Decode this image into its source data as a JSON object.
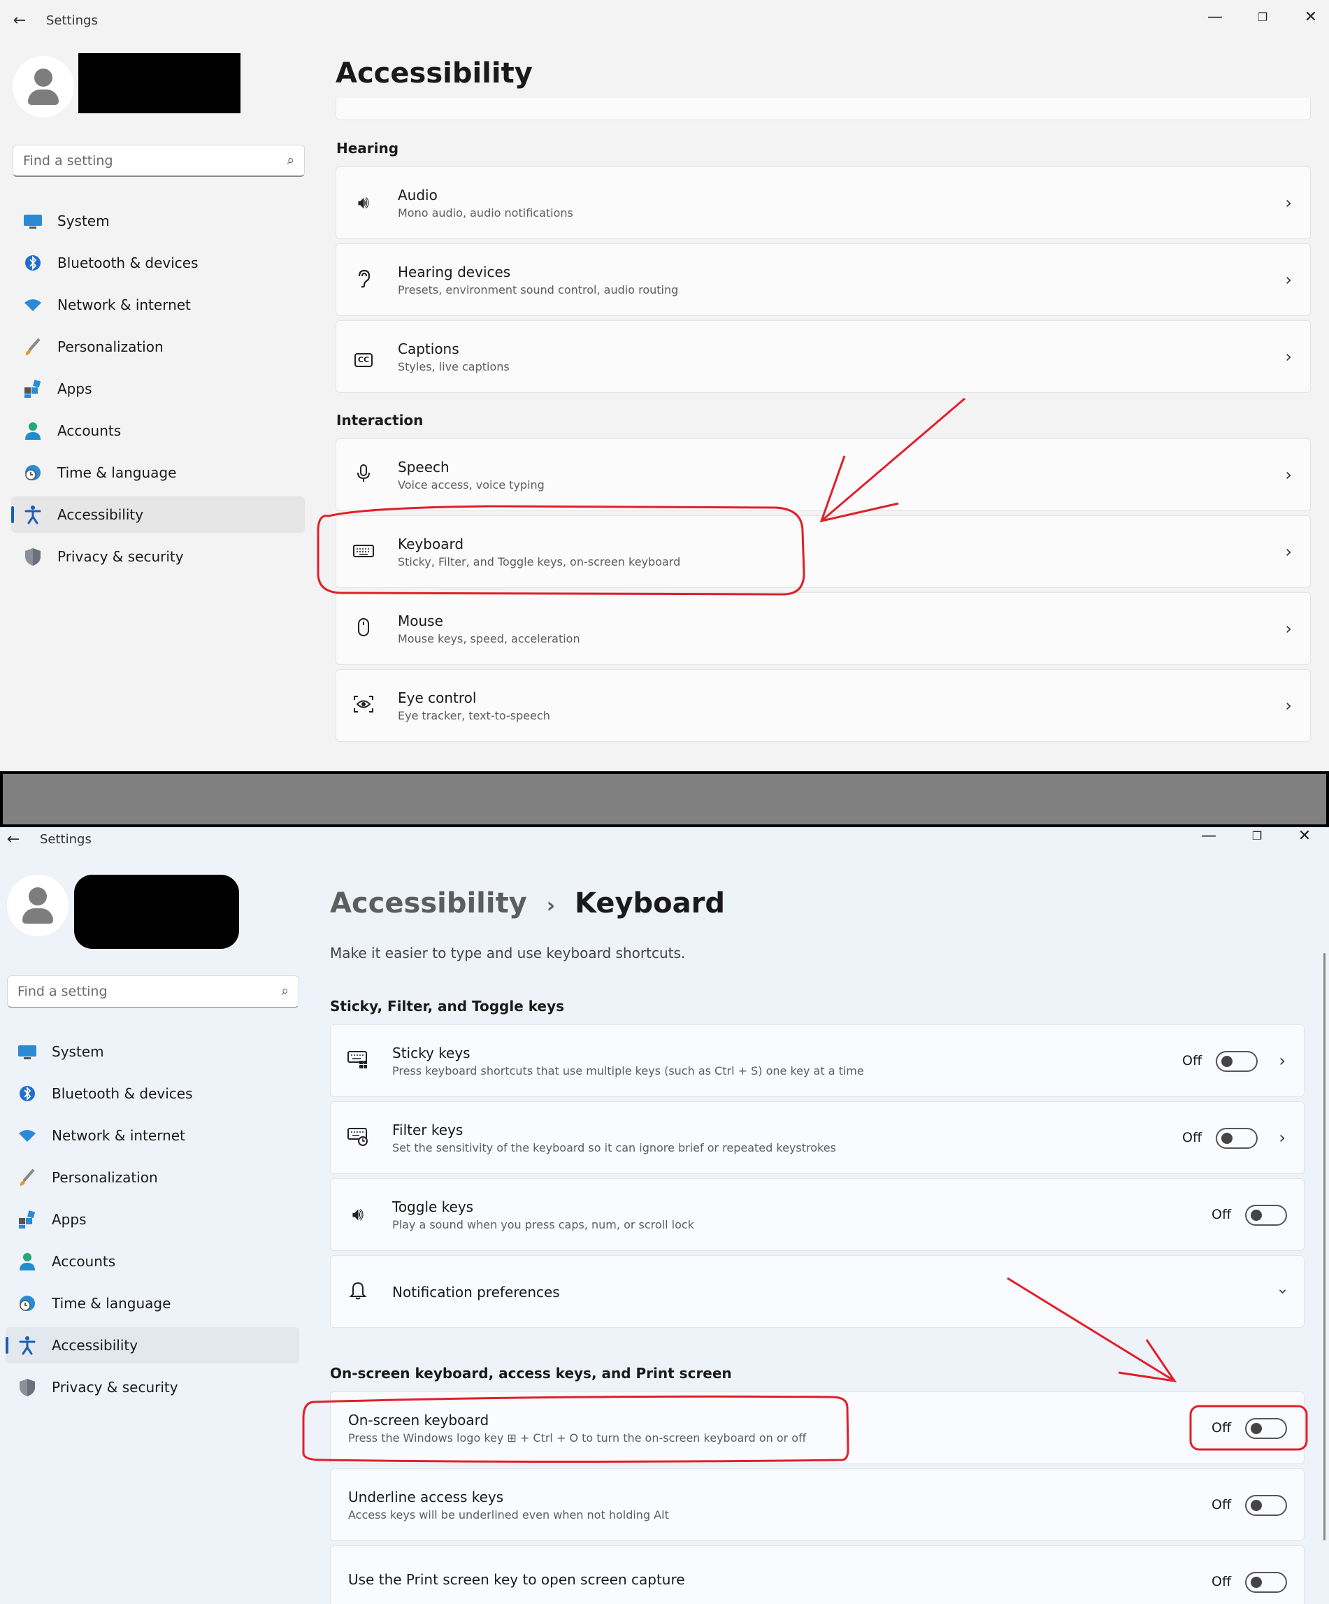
{
  "app": {
    "title": "Settings"
  },
  "window_controls": {
    "minimize": "—",
    "maximize": "❐",
    "close": "✕"
  },
  "search": {
    "placeholder": "Find a setting"
  },
  "nav": [
    {
      "label": "System",
      "icon": "monitor-icon"
    },
    {
      "label": "Bluetooth & devices",
      "icon": "bluetooth-icon"
    },
    {
      "label": "Network & internet",
      "icon": "wifi-icon"
    },
    {
      "label": "Personalization",
      "icon": "brush-icon"
    },
    {
      "label": "Apps",
      "icon": "apps-icon"
    },
    {
      "label": "Accounts",
      "icon": "person-icon"
    },
    {
      "label": "Time & language",
      "icon": "globe-clock-icon"
    },
    {
      "label": "Accessibility",
      "icon": "accessibility-icon",
      "active": true
    },
    {
      "label": "Privacy & security",
      "icon": "shield-icon"
    }
  ],
  "top": {
    "title": "Accessibility",
    "hearing_header": "Hearing",
    "hearing": [
      {
        "title": "Audio",
        "subtitle": "Mono audio, audio notifications",
        "icon": "speaker-icon"
      },
      {
        "title": "Hearing devices",
        "subtitle": "Presets, environment sound control, audio routing",
        "icon": "ear-icon"
      },
      {
        "title": "Captions",
        "subtitle": "Styles, live captions",
        "icon": "captions-icon"
      }
    ],
    "interaction_header": "Interaction",
    "interaction": [
      {
        "title": "Speech",
        "subtitle": "Voice access, voice typing",
        "icon": "microphone-icon"
      },
      {
        "title": "Keyboard",
        "subtitle": "Sticky, Filter, and Toggle keys, on-screen keyboard",
        "icon": "keyboard-icon"
      },
      {
        "title": "Mouse",
        "subtitle": "Mouse keys, speed, acceleration",
        "icon": "mouse-icon"
      },
      {
        "title": "Eye control",
        "subtitle": "Eye tracker, text-to-speech",
        "icon": "eye-control-icon"
      }
    ]
  },
  "bottom": {
    "breadcrumb_parent": "Accessibility",
    "breadcrumb_sep": "›",
    "breadcrumb_current": "Keyboard",
    "description": "Make it easier to type and use keyboard shortcuts.",
    "section1_header": "Sticky, Filter, and Toggle keys",
    "section1": [
      {
        "title": "Sticky keys",
        "subtitle": "Press keyboard shortcuts that use multiple keys (such as Ctrl + S) one key at a time",
        "state": "Off",
        "icon": "sticky-keys-icon",
        "chevron": true
      },
      {
        "title": "Filter keys",
        "subtitle": "Set the sensitivity of the keyboard so it can ignore brief or repeated keystrokes",
        "state": "Off",
        "icon": "filter-keys-icon",
        "chevron": true
      },
      {
        "title": "Toggle keys",
        "subtitle": "Play a sound when you press caps, num, or scroll lock",
        "state": "Off",
        "icon": "speaker-icon",
        "chevron": false
      }
    ],
    "notification": {
      "title": "Notification preferences",
      "icon": "bell-icon"
    },
    "section2_header": "On-screen keyboard, access keys, and Print screen",
    "section2": [
      {
        "title": "On-screen keyboard",
        "subtitle": "Press the Windows logo key ⊞ + Ctrl + O to turn the on-screen keyboard on or off",
        "state": "Off"
      },
      {
        "title": "Underline access keys",
        "subtitle": "Access keys will be underlined even when not holding Alt",
        "state": "Off"
      },
      {
        "title": "Use the Print screen key to open screen capture",
        "subtitle": "",
        "state": "Off"
      }
    ]
  },
  "annotation_color": "#e0202a"
}
